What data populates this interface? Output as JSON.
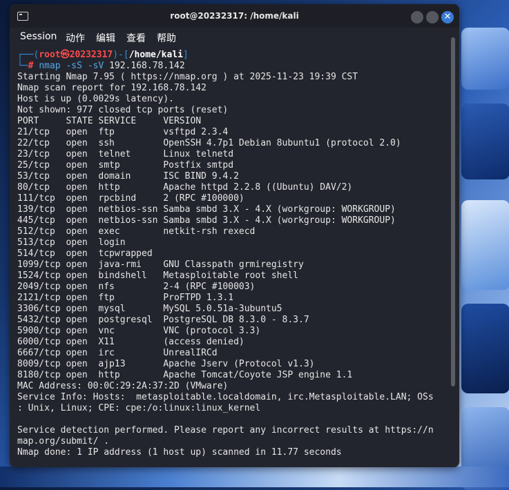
{
  "window": {
    "title": "root@20232317: /home/kali",
    "close_glyph": "✕"
  },
  "menu": [
    "Session",
    "动作",
    "编辑",
    "查看",
    "帮助"
  ],
  "prompt": {
    "open": "┌──(",
    "user": "root㉿20232317",
    "mid": ")-[",
    "path": "/home/kali",
    "close": "]",
    "second_prefix": "└─",
    "hash": "#",
    "command": "nmap",
    "args": "-sS -sV",
    "target": "192.168.78.142"
  },
  "output": [
    "Starting Nmap 7.95 ( https://nmap.org ) at 2025-11-23 19:39 CST",
    "Nmap scan report for 192.168.78.142",
    "Host is up (0.0029s latency).",
    "Not shown: 977 closed tcp ports (reset)",
    "PORT     STATE SERVICE     VERSION",
    "21/tcp   open  ftp         vsftpd 2.3.4",
    "22/tcp   open  ssh         OpenSSH 4.7p1 Debian 8ubuntu1 (protocol 2.0)",
    "23/tcp   open  telnet      Linux telnetd",
    "25/tcp   open  smtp        Postfix smtpd",
    "53/tcp   open  domain      ISC BIND 9.4.2",
    "80/tcp   open  http        Apache httpd 2.2.8 ((Ubuntu) DAV/2)",
    "111/tcp  open  rpcbind     2 (RPC #100000)",
    "139/tcp  open  netbios-ssn Samba smbd 3.X - 4.X (workgroup: WORKGROUP)",
    "445/tcp  open  netbios-ssn Samba smbd 3.X - 4.X (workgroup: WORKGROUP)",
    "512/tcp  open  exec        netkit-rsh rexecd",
    "513/tcp  open  login",
    "514/tcp  open  tcpwrapped",
    "1099/tcp open  java-rmi    GNU Classpath grmiregistry",
    "1524/tcp open  bindshell   Metasploitable root shell",
    "2049/tcp open  nfs         2-4 (RPC #100003)",
    "2121/tcp open  ftp         ProFTPD 1.3.1",
    "3306/tcp open  mysql       MySQL 5.0.51a-3ubuntu5",
    "5432/tcp open  postgresql  PostgreSQL DB 8.3.0 - 8.3.7",
    "5900/tcp open  vnc         VNC (protocol 3.3)",
    "6000/tcp open  X11         (access denied)",
    "6667/tcp open  irc         UnrealIRCd",
    "8009/tcp open  ajp13       Apache Jserv (Protocol v1.3)",
    "8180/tcp open  http        Apache Tomcat/Coyote JSP engine 1.1",
    "MAC Address: 00:0C:29:2A:37:2D (VMware)",
    "Service Info: Hosts:  metasploitable.localdomain, irc.Metasploitable.LAN; OSs",
    ": Unix, Linux; CPE: cpe:/o:linux:linux_kernel",
    "",
    "Service detection performed. Please report any incorrect results at https://n",
    "map.org/submit/ .",
    "Nmap done: 1 IP address (1 host up) scanned in 11.77 seconds"
  ],
  "colors": {
    "terminal_bg": "#23252e",
    "prompt_frame": "#2f8fd8",
    "prompt_user": "#ff4a4a",
    "command": "#56a8e6",
    "close_button": "#3a7bd5"
  }
}
